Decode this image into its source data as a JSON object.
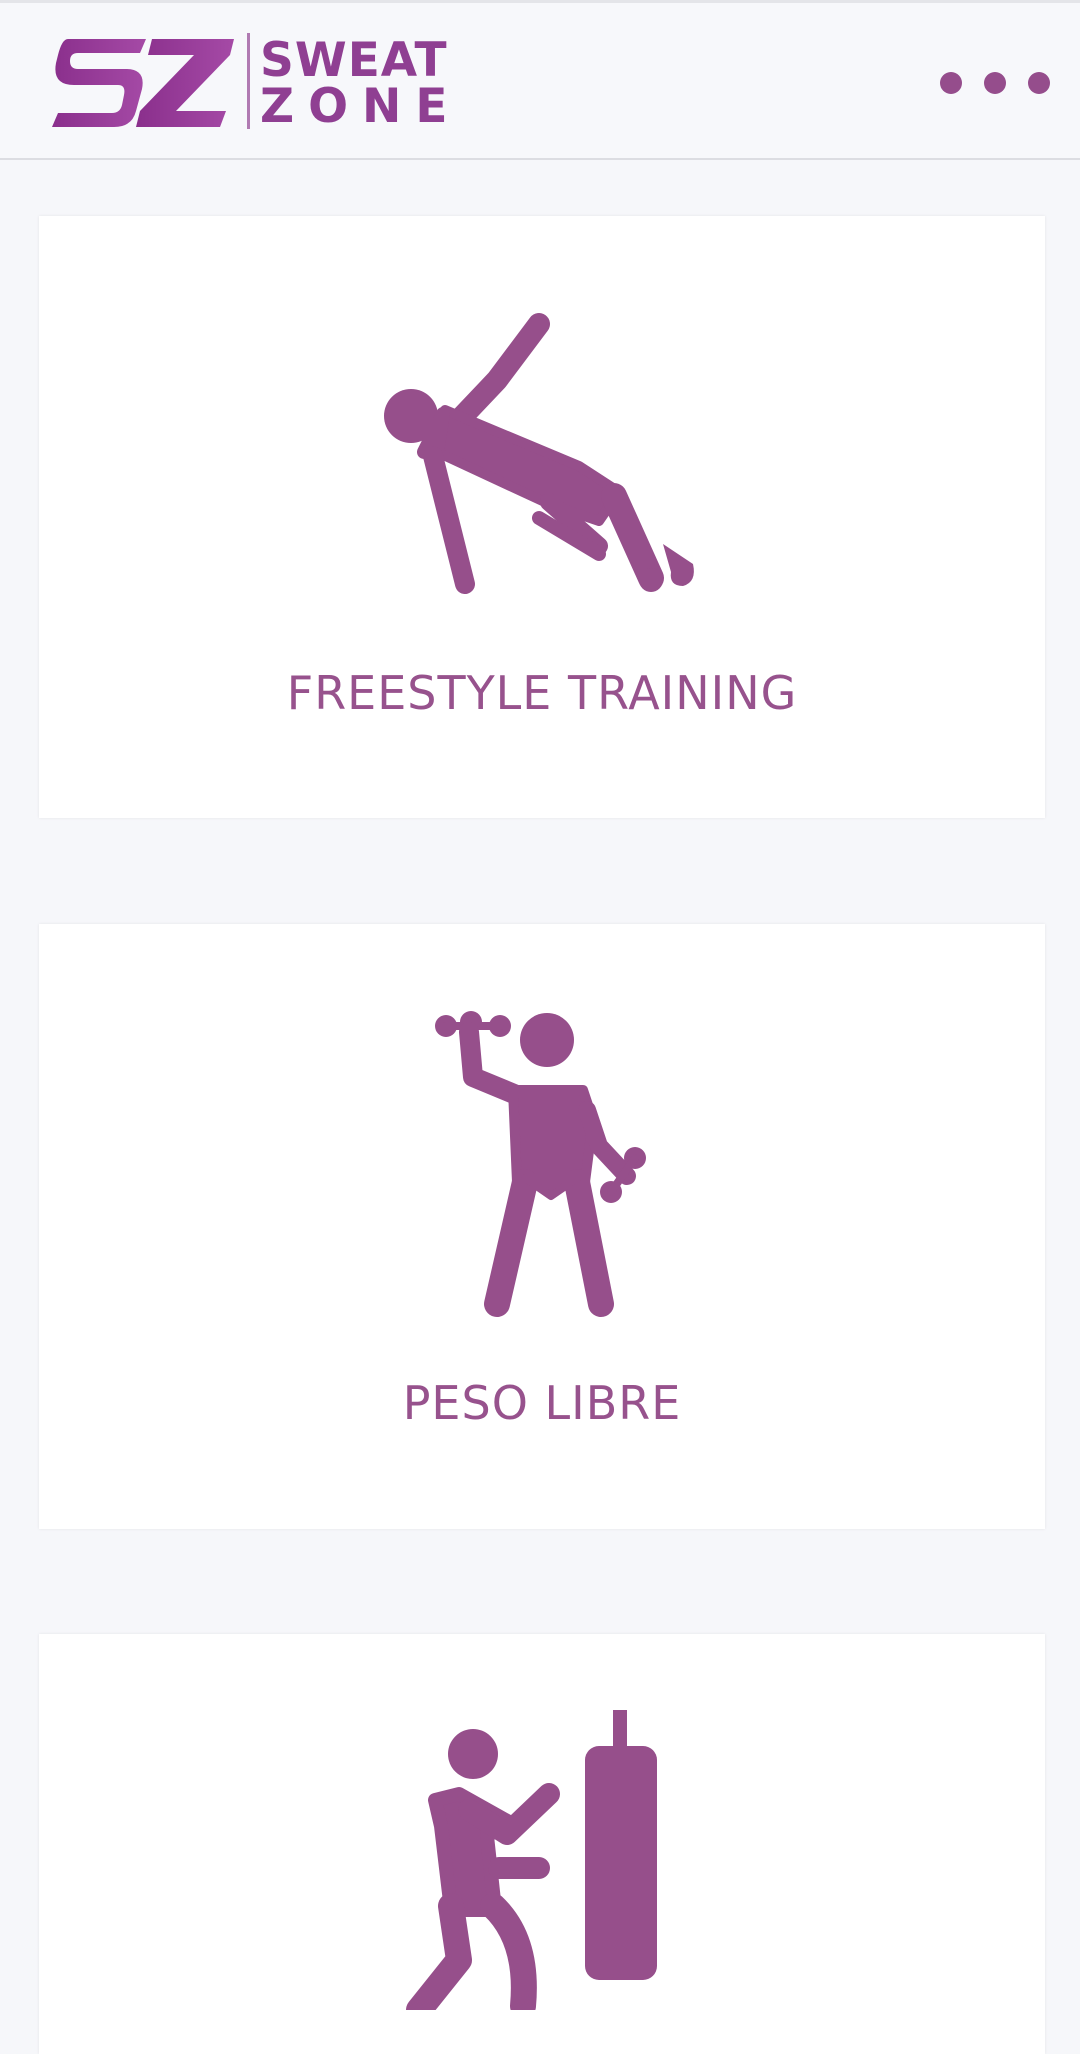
{
  "header": {
    "logo": {
      "monogram": "SZ",
      "word1": "SWEAT",
      "word2": "ZONE"
    },
    "menu_icon": "more-horizontal-icon"
  },
  "cards": [
    {
      "label": "FREESTYLE TRAINING",
      "icon": "freestyle-training-icon"
    },
    {
      "label": "PESO LIBRE",
      "icon": "dumbbell-weights-icon"
    },
    {
      "label": "",
      "icon": "punching-bag-icon"
    }
  ],
  "colors": {
    "brand": "#8f3f92",
    "icon": "#964f8b",
    "background": "#f6f7fa",
    "card": "#ffffff"
  }
}
